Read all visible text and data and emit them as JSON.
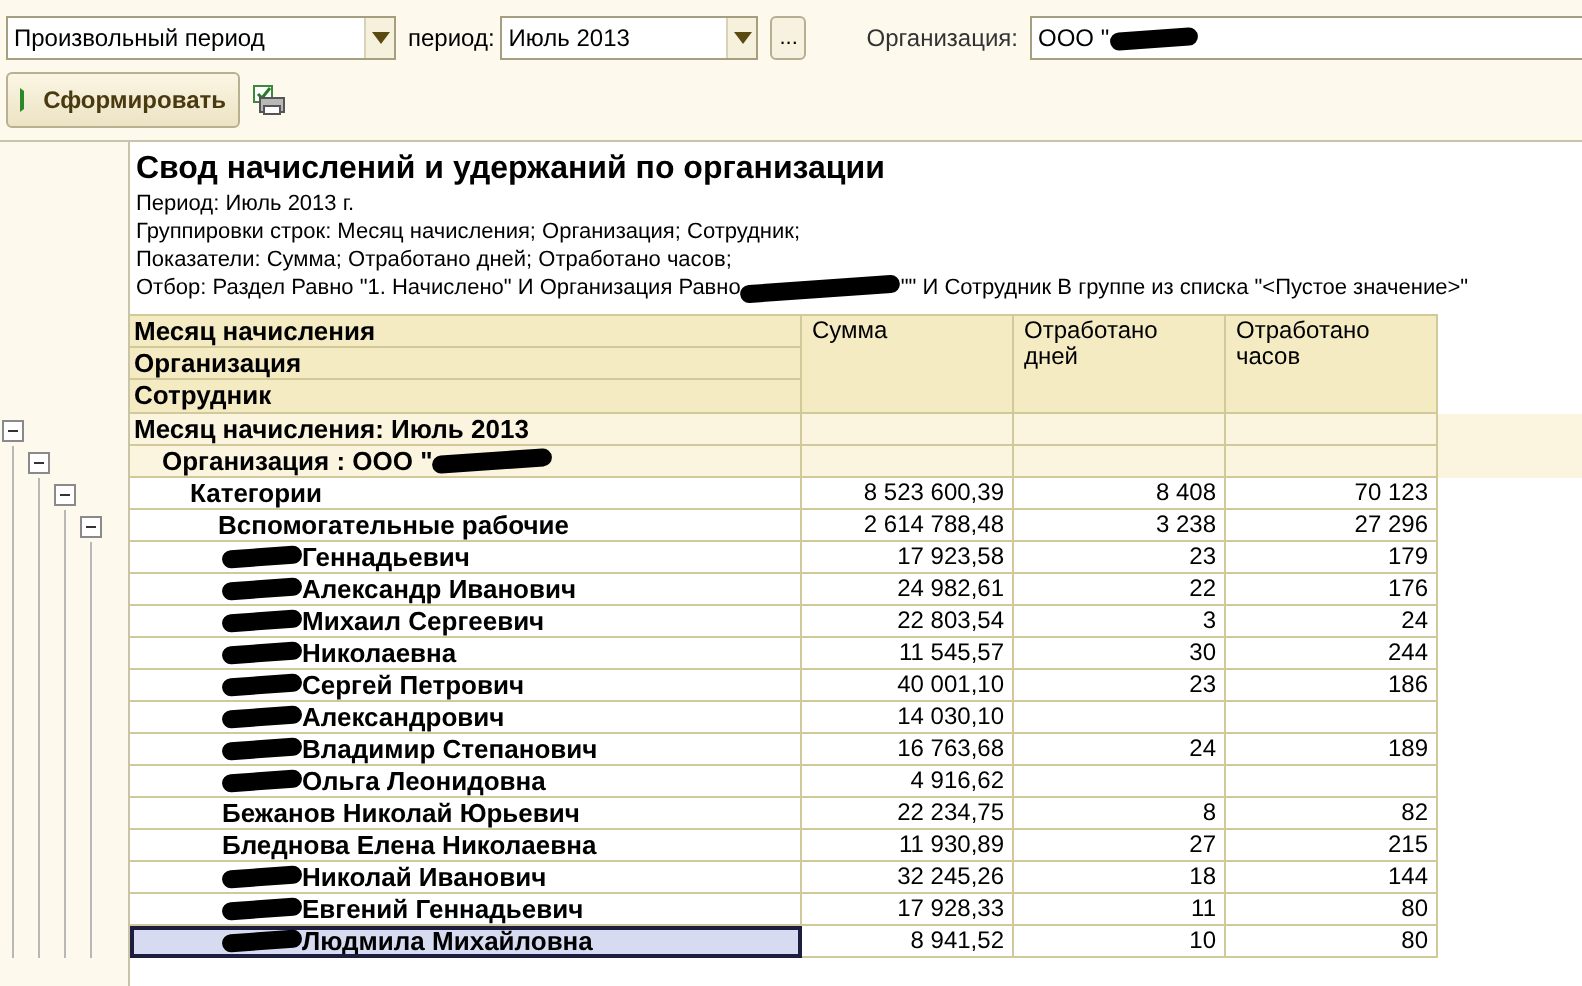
{
  "filters": {
    "period_type": "Произвольный период",
    "period_label": "период:",
    "period": "Июль 2013",
    "choose_button": "...",
    "org_label": "Организация:",
    "org": "ООО \"",
    "org_redacted": true
  },
  "toolbar": {
    "generate_button": "Сформировать"
  },
  "report": {
    "title": "Свод начислений и удержаний по организации",
    "lines": [
      {
        "text": "Период: Июль 2013 г."
      },
      {
        "text": "Группировки строк: Месяц начисления; Организация; Сотрудник;"
      },
      {
        "text": "Показатели: Сумма; Отработано дней; Отработано часов;"
      },
      {
        "text": "Отбор: Раздел Равно \"1. Начислено\" И Организация Равно ",
        "redacted": true,
        "after": "\"\" И Сотрудник В группе из списка \"<Пустое значение>\""
      }
    ],
    "columns": {
      "group_headers": [
        "Месяц начисления",
        "Организация",
        "Сотрудник"
      ],
      "values": [
        "Сумма",
        "Отработано дней",
        "Отработано часов"
      ]
    },
    "rows": [
      {
        "kind": "group",
        "label": "Месяц начисления: Июль 2013",
        "expanded": true,
        "children": [
          {
            "kind": "group",
            "label": "Организация : ООО \"",
            "redacted": true,
            "expanded": true,
            "children": [
              {
                "kind": "total",
                "label": "Категории",
                "expanded": true,
                "values": [
                  "8 523 600,39",
                  "8 408",
                  "70 123"
                ],
                "children": [
                  {
                    "kind": "total",
                    "label": "Вспомогательные рабочие",
                    "expanded": true,
                    "values": [
                      "2 614 788,48",
                      "3 238",
                      "27 296"
                    ],
                    "children": [
                      {
                        "kind": "person",
                        "label": "Геннадьевич",
                        "redacted": true,
                        "selected": false,
                        "values": [
                          "17 923,58",
                          "23",
                          "179"
                        ]
                      },
                      {
                        "kind": "person",
                        "label": "Александр Иванович",
                        "redacted": true,
                        "selected": false,
                        "values": [
                          "24 982,61",
                          "22",
                          "176"
                        ]
                      },
                      {
                        "kind": "person",
                        "label": "Михаил Сергеевич",
                        "redacted": true,
                        "selected": false,
                        "values": [
                          "22 803,54",
                          "3",
                          "24"
                        ]
                      },
                      {
                        "kind": "person",
                        "label": "Николаевна",
                        "redacted": true,
                        "selected": false,
                        "values": [
                          "11 545,57",
                          "30",
                          "244"
                        ]
                      },
                      {
                        "kind": "person",
                        "label": "Сергей Петрович",
                        "redacted": true,
                        "selected": false,
                        "values": [
                          "40 001,10",
                          "23",
                          "186"
                        ]
                      },
                      {
                        "kind": "person",
                        "label": "Александрович",
                        "redacted": true,
                        "selected": false,
                        "values": [
                          "14 030,10"
                        ]
                      },
                      {
                        "kind": "person",
                        "label": "Владимир Степанович",
                        "redacted": true,
                        "selected": false,
                        "values": [
                          "16 763,68",
                          "24",
                          "189"
                        ]
                      },
                      {
                        "kind": "person",
                        "label": "Ольга Леонидовна",
                        "redacted": true,
                        "selected": false,
                        "values": [
                          "4 916,62"
                        ]
                      },
                      {
                        "kind": "person",
                        "label": "Бежанов Николай Юрьевич",
                        "selected": false,
                        "values": [
                          "22 234,75",
                          "8",
                          "82"
                        ]
                      },
                      {
                        "kind": "person",
                        "label": "Бледнова Елена Николаевна",
                        "selected": false,
                        "values": [
                          "11 930,89",
                          "27",
                          "215"
                        ]
                      },
                      {
                        "kind": "person",
                        "label": "Николай Иванович",
                        "redacted": true,
                        "selected": false,
                        "values": [
                          "32 245,26",
                          "18",
                          "144"
                        ]
                      },
                      {
                        "kind": "person",
                        "label": "Евгений Геннадьевич",
                        "redacted": true,
                        "selected": false,
                        "values": [
                          "17 928,33",
                          "11",
                          "80"
                        ]
                      },
                      {
                        "kind": "person",
                        "label": "Людмила Михайловна",
                        "redacted": true,
                        "selected": true,
                        "values": [
                          "8 941,52",
                          "10",
                          "80"
                        ]
                      }
                    ]
                  }
                ]
              }
            ]
          }
        ]
      }
    ]
  }
}
